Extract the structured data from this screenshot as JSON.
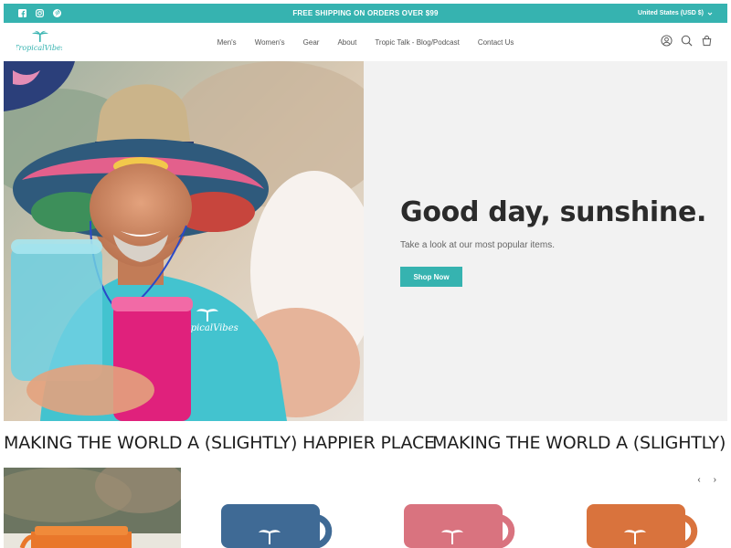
{
  "announcement": {
    "message": "FREE SHIPPING ON ORDERS OVER $99",
    "region": "United States (USD $)",
    "bg_color": "#36b3b0",
    "social_icons": [
      "facebook-icon",
      "instagram-icon",
      "pinterest-icon"
    ]
  },
  "header": {
    "logo_text": "TropicalVibes",
    "nav": [
      "Men's",
      "Women's",
      "Gear",
      "About",
      "Tropic Talk - Blog/Podcast",
      "Contact Us"
    ],
    "icons": [
      "account-icon",
      "search-icon",
      "cart-icon"
    ]
  },
  "hero": {
    "title": "Good day, sunshine.",
    "subtitle": "Take a look at our most popular items.",
    "cta_label": "Shop Now",
    "shirt_logo_text": "TropicalVibes"
  },
  "marquee": {
    "text": "MAKING THE WORLD A (SLIGHTLY) HAPPIER PLACE",
    "text_repeat": "MAKING THE WORLD A (SLIGHTLY) HA"
  },
  "products": {
    "prev_label": "‹",
    "next_label": "›",
    "mug_colors": [
      "#3f6a95",
      "#d9737f",
      "#d9733d"
    ]
  },
  "colors": {
    "accent": "#36b3b0",
    "hero_panel_bg": "#f2f2f2"
  }
}
